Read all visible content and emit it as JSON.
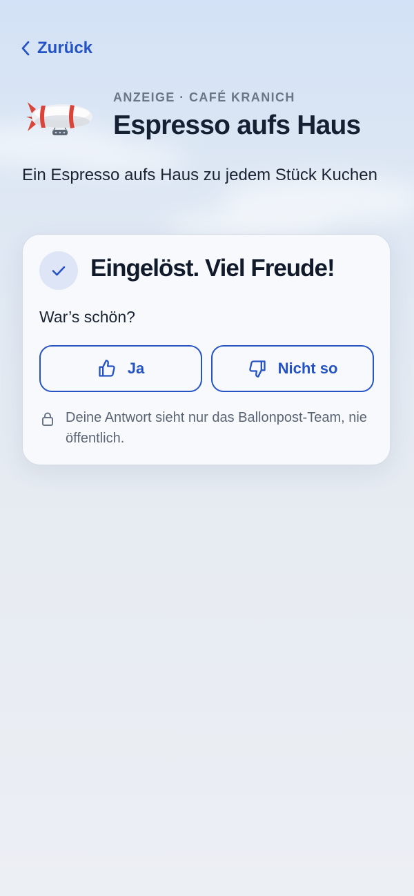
{
  "nav": {
    "back_label": "Zurück",
    "back_icon": "chevron-left-icon"
  },
  "offer": {
    "hero_icon": "airship-icon",
    "eyebrow": "ANZEIGE · CAFÉ KRANICH",
    "title": "Espresso aufs Haus",
    "description": "Ein Espresso aufs Haus zu jedem Stück Kuchen"
  },
  "feedback_card": {
    "status_icon": "check-icon",
    "title": "Eingelöst. Viel Freude!",
    "question": "War’s schön?",
    "yes_label": "Ja",
    "yes_icon": "thumbs-up-icon",
    "no_label": "Nicht so",
    "no_icon": "thumbs-down-icon",
    "privacy_icon": "lock-icon",
    "privacy_note": "Deine Antwort sieht nur das Ballonpost-Team, nie öffentlich."
  },
  "colors": {
    "accent": "#2553c4",
    "text_primary": "#152033",
    "text_muted": "#6a7585",
    "badge_bg": "#dde5f6",
    "card_bg": "#f7f9fc"
  }
}
